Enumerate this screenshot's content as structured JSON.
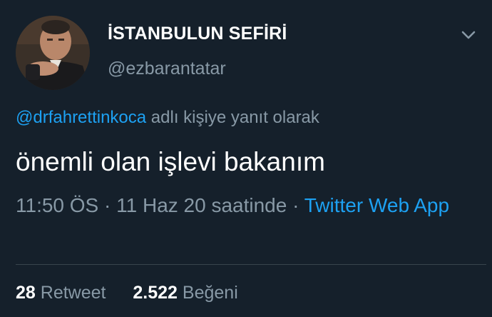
{
  "user": {
    "display_name": "İSTANBULUN SEFİRİ",
    "handle": "@ezbarantatar"
  },
  "icons": {
    "menu": "chevron-down-icon"
  },
  "reply": {
    "mention": "@drfahrettinkoca",
    "suffix": "adlı kişiye yanıt olarak"
  },
  "tweet": {
    "text": "önemli olan işlevi bakanım"
  },
  "meta": {
    "time": "11:50 ÖS",
    "separator": "·",
    "date": "11 Haz 20 saatinde",
    "source": "Twitter Web App"
  },
  "stats": {
    "retweet_count": "28",
    "retweet_label": "Retweet",
    "like_count": "2.522",
    "like_label": "Beğeni"
  },
  "colors": {
    "background": "#15202b",
    "primary_text": "#ffffff",
    "secondary_text": "#8899a6",
    "accent": "#1da1f2",
    "divider": "#38444d"
  }
}
